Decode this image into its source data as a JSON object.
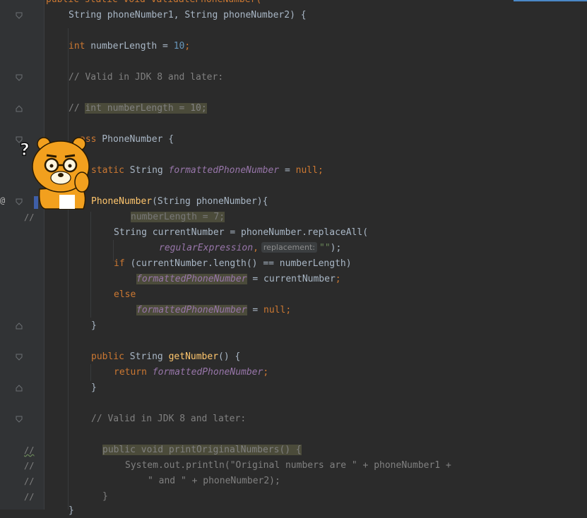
{
  "editor": {
    "lines": {
      "l0_text": "public static void validatePhoneNumber(",
      "l1_text": "String phoneNumber1, String phoneNumber2) {",
      "l2_kw": "int",
      "l2_var": " numberLength = ",
      "l2_num": "10",
      "l2_semi": ";",
      "l3_comment": "// Valid in JDK 8 and later:",
      "l4_prefix": "// ",
      "l4_hl": "int numberLength = 10;",
      "l5_kw": "ass",
      "l5_rest": " PhoneNumber {",
      "l6_kw": "static",
      "l6_type": " String ",
      "l6_field": "formattedPhoneNumber",
      "l6_eq": " = ",
      "l6_null": "null",
      "l6_semi": ";",
      "l7_method": "PhoneNumber",
      "l7_rest": "(String phoneNumber){",
      "l8_gutter": "//",
      "l8_hl": "numberLength = 7;",
      "l9_text": "String currentNumber = phoneNumber.replaceAll(",
      "l10_param": "regularExpression",
      "l10_comma": ",",
      "l10_hint": "replacement:",
      "l10_str": "\"\"",
      "l10_end": ");",
      "l11_kw": "if",
      "l11_rest": " (currentNumber.length() == numberLength)",
      "l12_field": "formattedPhoneNumber",
      "l12_rest": " = currentNumber",
      "l12_semi": ";",
      "l13_kw": "else",
      "l14_field": "formattedPhoneNumber",
      "l14_eq": " = ",
      "l14_null": "null",
      "l14_semi": ";",
      "l15_brace": "}",
      "l16_kw": "public",
      "l16_type": " String ",
      "l16_method": "getNumber",
      "l16_rest": "() {",
      "l17_kw": "return",
      "l17_field": " formattedPhoneNumber",
      "l17_semi": ";",
      "l18_brace": "}",
      "l19_comment": "// Valid in JDK 8 and later:",
      "l20_gutter": "//",
      "l20_hl": "public void printOriginalNumbers() {",
      "l21_gutter": "//",
      "l21_text": "System.out.println(\"Original numbers are \" + phoneNumber1 +",
      "l22_gutter": "//",
      "l22_text": "\" and \" + phoneNumber2);",
      "l23_gutter": "//",
      "l23_brace": "}",
      "l24_brace": "}"
    },
    "gutter": {
      "override_marker": "@"
    }
  },
  "colors": {
    "background": "#2b2b2b",
    "keyword": "#cc7832",
    "number": "#6897bb",
    "comment": "#808080",
    "field": "#9876aa",
    "method": "#ffc66d",
    "string": "#6a8759"
  },
  "icons": {
    "fold": "fold-marker-icon",
    "mascot": "bear-mascot-question-icon"
  }
}
